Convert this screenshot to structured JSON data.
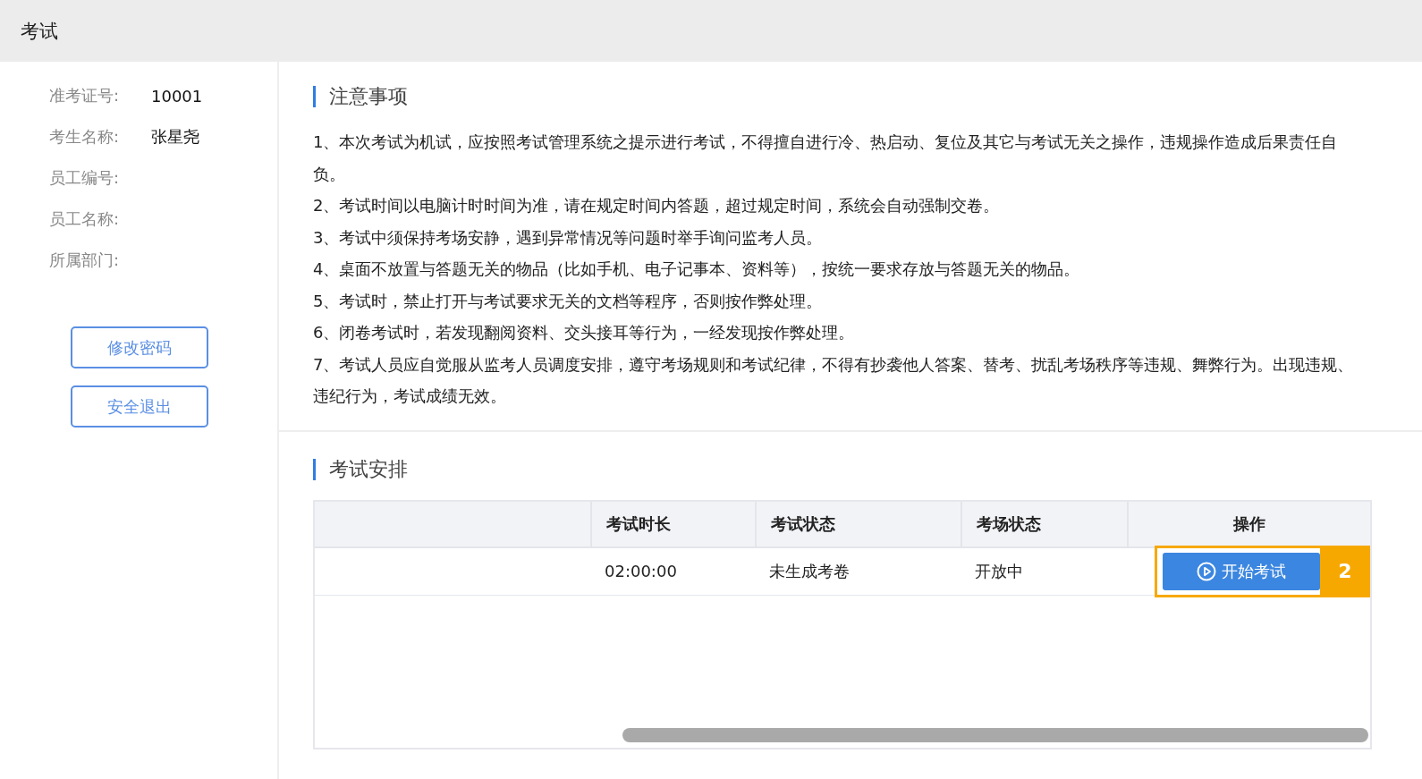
{
  "window": {
    "title": "考试"
  },
  "profile": [
    {
      "label": "准考证号:",
      "value": "10001"
    },
    {
      "label": "考生名称:",
      "value": "张星尧"
    },
    {
      "label": "员工编号:"
    },
    {
      "label": "员工名称:"
    },
    {
      "label": "所属部门:"
    }
  ],
  "sidebar_buttons": [
    "修改密码",
    "安全退出"
  ],
  "notice": {
    "title": "注意事项",
    "items": [
      "1、本次考试为机试，应按照考试管理系统之提示进行考试，不得擅自进行冷、热启动、复位及其它与考试无关之操作，违规操作造成后果责任自负。",
      "2、考试时间以电脑计时时间为准，请在规定时间内答题，超过规定时间，系统会自动强制交卷。",
      "3、考试中须保持考场安静，遇到异常情况等问题时举手询问监考人员。",
      "4、桌面不放置与答题无关的物品（比如手机、电子记事本、资料等），按统一要求存放与答题无关的物品。",
      "5、考试时，禁止打开与考试要求无关的文档等程序，否则按作弊处理。",
      "6、闭卷考试时，若发现翻阅资料、交头接耳等行为，一经发现按作弊处理。",
      "7、考试人员应自觉服从监考人员调度安排，遵守考场规则和考试纪律，不得有抄袭他人答案、替考、扰乱考场秩序等违规、舞弊行为。出现违规、违纪行为，考试成绩无效。"
    ]
  },
  "schedule": {
    "title": "考试安排",
    "columns": [
      "考试时长",
      "考试状态",
      "考场状态",
      "操作"
    ],
    "rows": [
      {
        "duration": "02:00:00",
        "exam_status": "未生成考卷",
        "room_status": "开放中",
        "action": "开始考试",
        "highlighted": true
      }
    ]
  },
  "callout": {
    "label": "2"
  }
}
